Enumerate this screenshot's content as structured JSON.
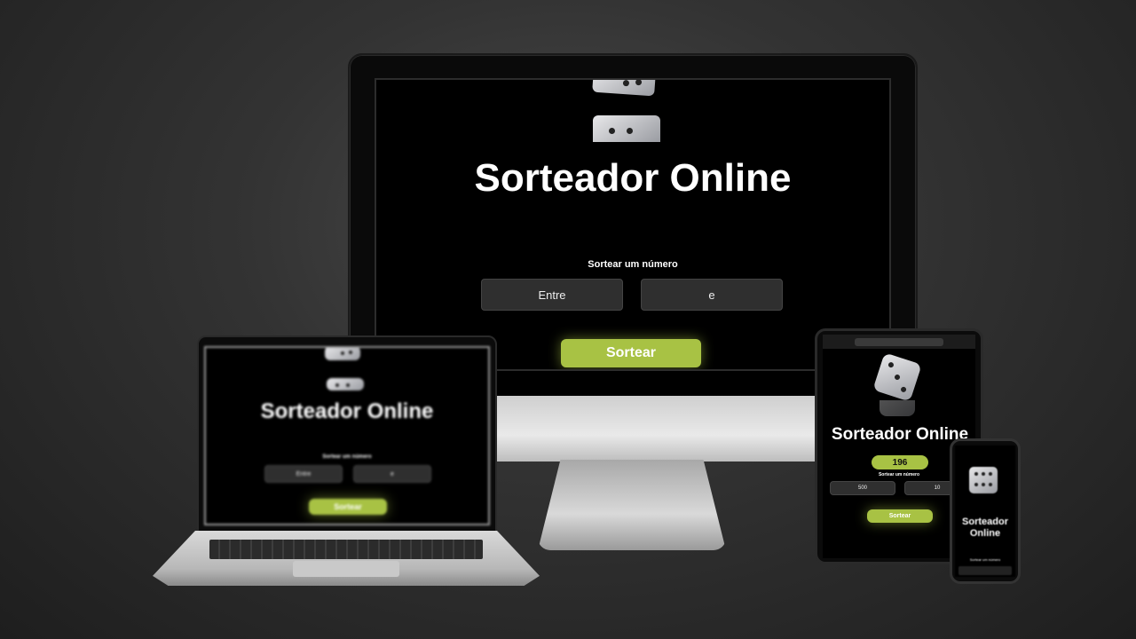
{
  "site": {
    "title": "Sorteador Online",
    "prompt_label": "Sortear um número",
    "input_from_placeholder": "Entre",
    "input_to_placeholder": "e",
    "button_label": "Sortear"
  },
  "tablet": {
    "result": "196",
    "input_from_value": "500",
    "input_to_value": "10"
  },
  "colors": {
    "accent": "#a8c244",
    "background": "#000000",
    "input_bg": "#2f2f2f"
  },
  "icons": {
    "dice": "dice-icon"
  }
}
